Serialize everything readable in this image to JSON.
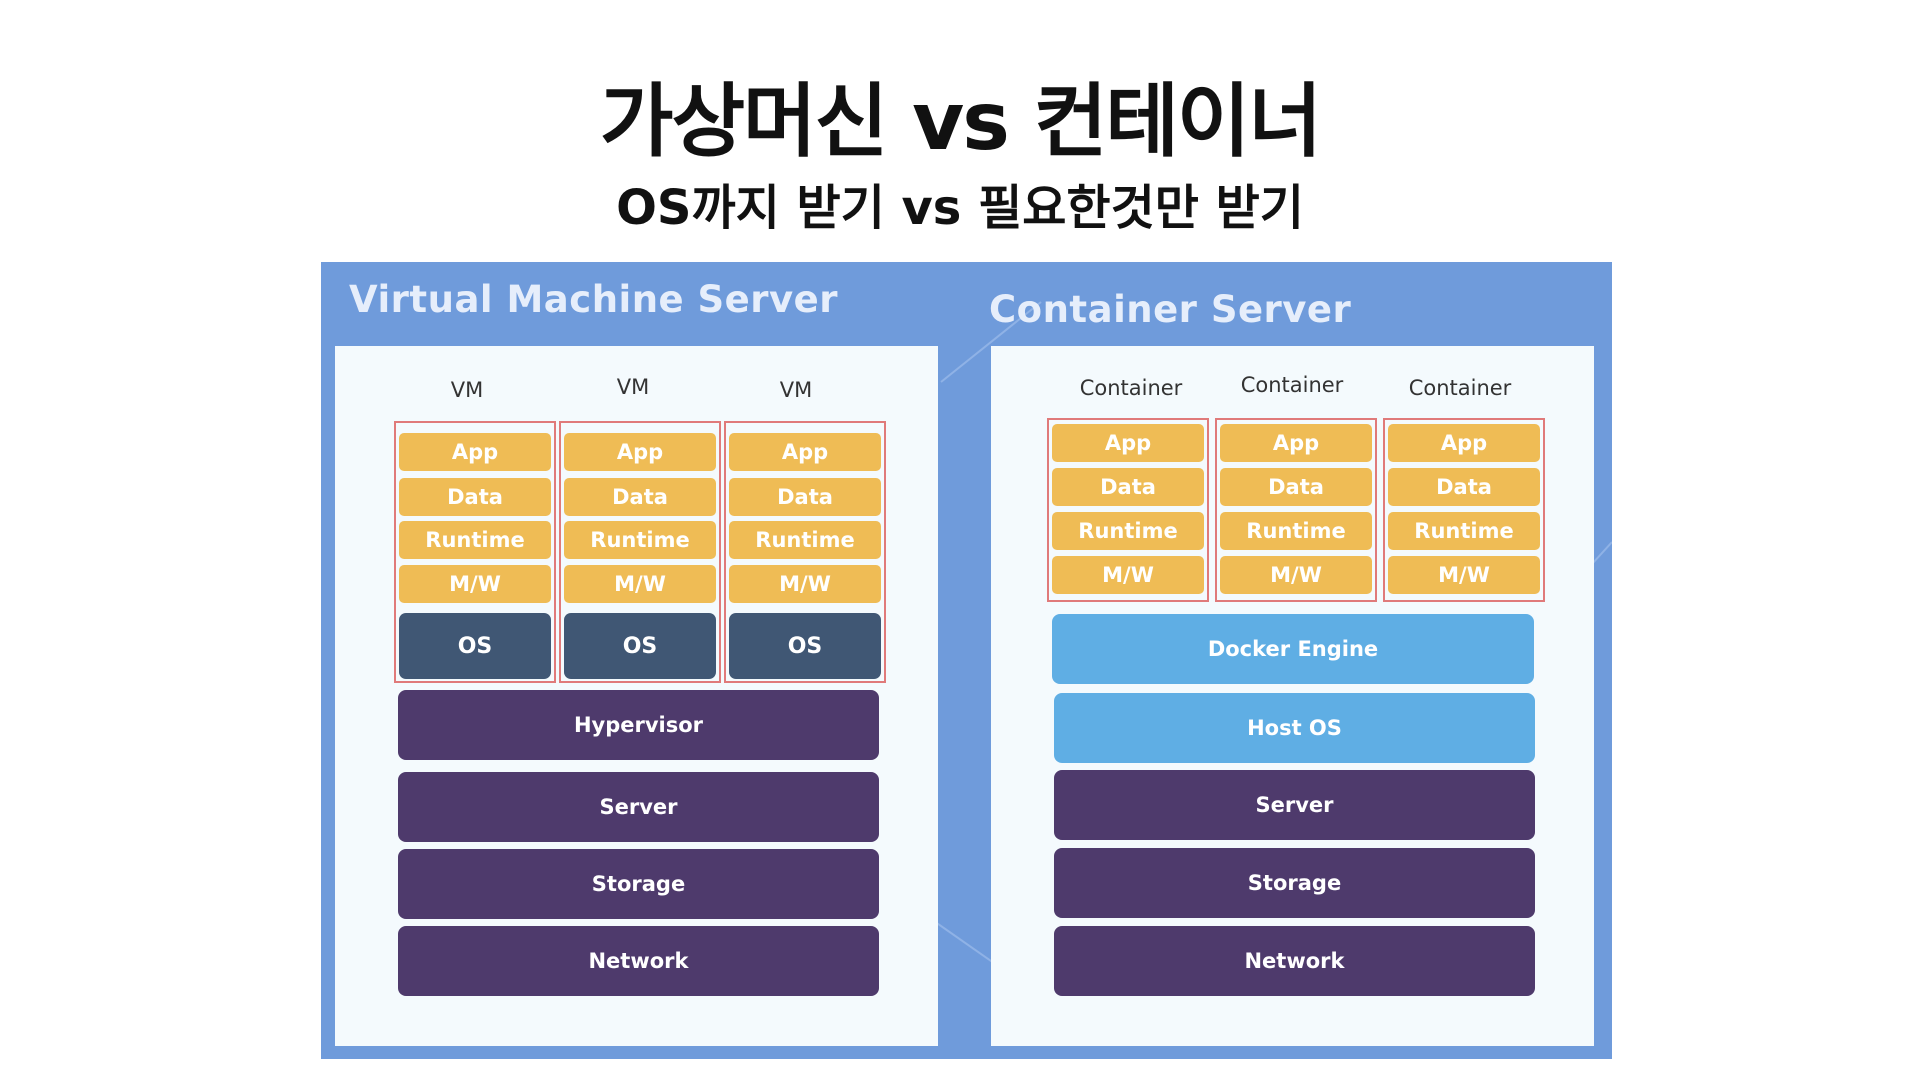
{
  "title": "가상머신 vs 컨테이너",
  "subtitle": "OS까지 받기 vs 필요한것만 받기",
  "vm_server": {
    "title": "Virtual Machine Server",
    "columns": [
      {
        "label": "VM",
        "app": "App",
        "data": "Data",
        "runtime": "Runtime",
        "mw": "M/W",
        "os": "OS"
      },
      {
        "label": "VM",
        "app": "App",
        "data": "Data",
        "runtime": "Runtime",
        "mw": "M/W",
        "os": "OS"
      },
      {
        "label": "VM",
        "app": "App",
        "data": "Data",
        "runtime": "Runtime",
        "mw": "M/W",
        "os": "OS"
      }
    ],
    "hypervisor": "Hypervisor",
    "server": "Server",
    "storage": "Storage",
    "network": "Network"
  },
  "container_server": {
    "title": "Container Server",
    "columns": [
      {
        "label": "Container",
        "app": "App",
        "data": "Data",
        "runtime": "Runtime",
        "mw": "M/W"
      },
      {
        "label": "Container",
        "app": "App",
        "data": "Data",
        "runtime": "Runtime",
        "mw": "M/W"
      },
      {
        "label": "Container",
        "app": "App",
        "data": "Data",
        "runtime": "Runtime",
        "mw": "M/W"
      }
    ],
    "docker_engine": "Docker Engine",
    "host_os": "Host OS",
    "server": "Server",
    "storage": "Storage",
    "network": "Network"
  },
  "colors": {
    "panel": "#6f9bdb",
    "inner": "#f4fafd",
    "layer_yellow": "#efbc55",
    "os_dark": "#405774",
    "infra_purple": "#4e3a6c",
    "docker_blue": "#5faee4",
    "stack_border": "#e07a7a"
  }
}
